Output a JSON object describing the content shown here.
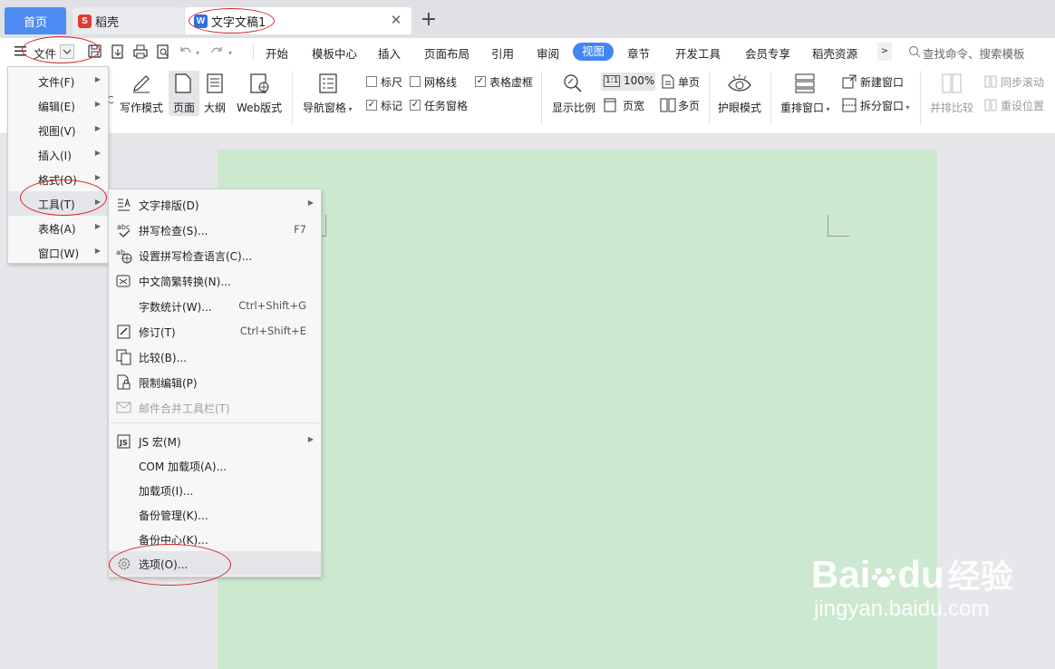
{
  "tabs": {
    "home": "首页",
    "daoke": "稻壳",
    "doc": "文字文稿1",
    "daoke_logo": "S",
    "doc_logo": "W"
  },
  "menubar": {
    "file_label": "文件",
    "ribbon_tabs": [
      "开始",
      "模板中心",
      "插入",
      "页面布局",
      "引用",
      "审阅",
      "视图",
      "章节",
      "开发工具",
      "会员专享",
      "稻壳资源"
    ],
    "active_tab": "视图",
    "search_placeholder": "查找命令、搜索模板"
  },
  "ribbon": {
    "write_mode": "写作模式",
    "page": "页面",
    "outline": "大纲",
    "web_layout": "Web版式",
    "nav_pane": "导航窗格",
    "ruler": "标尺",
    "gridlines": "网格线",
    "table_gridlines": "表格虚框",
    "marks": "标记",
    "task_pane": "任务窗格",
    "zoom": "显示比例",
    "zoom_value": "100%",
    "zoom_prefix": "1:1",
    "page_width": "页宽",
    "single_page": "单页",
    "multi_page": "多页",
    "eye_mode": "护眼模式",
    "rearrange": "重排窗口",
    "new_window": "新建窗口",
    "split_window": "拆分窗口",
    "side_by_side": "并排比较",
    "sync_scroll": "同步滚动",
    "reset_pos": "重设位置",
    "checks": {
      "ruler": false,
      "gridlines": false,
      "table_gridlines": true,
      "marks": true,
      "task_pane": true
    }
  },
  "file_menu": [
    {
      "label": "文件(F)"
    },
    {
      "label": "编辑(E)"
    },
    {
      "label": "视图(V)"
    },
    {
      "label": "插入(I)"
    },
    {
      "label": "格式(O)"
    },
    {
      "label": "工具(T)"
    },
    {
      "label": "表格(A)"
    },
    {
      "label": "窗口(W)"
    }
  ],
  "tools_menu": {
    "items": [
      {
        "label": "文字排版(D)",
        "shortcut": "",
        "icon": "text-layout-icon"
      },
      {
        "label": "拼写检查(S)...",
        "shortcut": "F7",
        "icon": "spell-check-icon"
      },
      {
        "label": "设置拼写检查语言(C)...",
        "shortcut": "",
        "icon": "spell-language-icon"
      },
      {
        "label": "中文简繁转换(N)...",
        "shortcut": "",
        "icon": "chinese-convert-icon"
      },
      {
        "label": "字数统计(W)...",
        "shortcut": "Ctrl+Shift+G",
        "icon": ""
      },
      {
        "label": "修订(T)",
        "shortcut": "Ctrl+Shift+E",
        "icon": "track-changes-icon"
      },
      {
        "label": "比较(B)...",
        "shortcut": "",
        "icon": "compare-icon"
      },
      {
        "label": "限制编辑(P)",
        "shortcut": "",
        "icon": "restrict-edit-icon"
      },
      {
        "label": "邮件合并工具栏(T)",
        "shortcut": "",
        "icon": "mail-merge-icon"
      },
      {
        "label": "JS 宏(M)",
        "shortcut": "",
        "icon": "js-macro-icon"
      },
      {
        "label": "COM 加载项(A)...",
        "shortcut": "",
        "icon": ""
      },
      {
        "label": "加载项(I)...",
        "shortcut": "",
        "icon": ""
      },
      {
        "label": "备份管理(K)...",
        "shortcut": "",
        "icon": ""
      },
      {
        "label": "备份中心(K)...",
        "shortcut": "",
        "icon": ""
      },
      {
        "label": "选项(O)...",
        "shortcut": "",
        "icon": "gear-icon"
      }
    ]
  },
  "watermark": {
    "brand": "Bai",
    "brand2": "du",
    "brand_cn": "经验",
    "url": "jingyan.baidu.com"
  },
  "colors": {
    "accent": "#4286f5",
    "page_bg": "#cce8cf",
    "annotation": "#d6272b"
  }
}
